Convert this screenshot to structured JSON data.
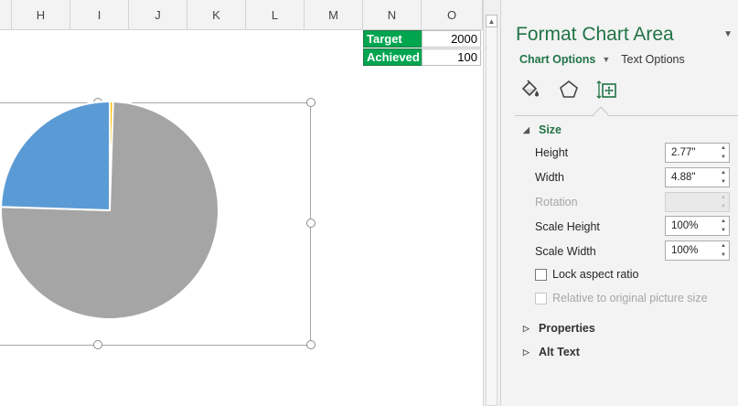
{
  "sheet": {
    "columns": [
      {
        "letter": "H"
      },
      {
        "letter": "I"
      },
      {
        "letter": "J"
      },
      {
        "letter": "K"
      },
      {
        "letter": "L"
      },
      {
        "letter": "M"
      },
      {
        "letter": "N"
      },
      {
        "letter": "O"
      }
    ],
    "cells": {
      "target_label": "Target",
      "target_value": "2000",
      "achieved_label": "Achieved",
      "achieved_value": "100"
    },
    "colors": {
      "header_green": "#00a54f",
      "pie_blue": "#5b9bd5",
      "pie_gray": "#a5a5a5",
      "pie_gold": "#ffc000"
    }
  },
  "chart_data": {
    "type": "pie",
    "slices": [
      {
        "value": 75,
        "color": "#a5a5a5"
      },
      {
        "value": 24.5,
        "color": "#5b9bd5"
      },
      {
        "value": 0.5,
        "color": "#ffc000"
      }
    ]
  },
  "pane": {
    "title": "Format Chart Area",
    "tabs": {
      "chart_options": "Chart Options",
      "text_options": "Text Options"
    },
    "icons": [
      "fill-line-icon",
      "effects-icon",
      "size-properties-icon"
    ],
    "sections": {
      "size": "Size",
      "properties": "Properties",
      "alt_text": "Alt Text"
    },
    "rows": {
      "height_label": "Height",
      "height_value": "2.77\"",
      "width_label": "Width",
      "width_value": "4.88\"",
      "rotation_label": "Rotation",
      "scale_height_label": "Scale Height",
      "scale_height_value": "100%",
      "scale_width_label": "Scale Width",
      "scale_width_value": "100%",
      "lock_aspect_label": "Lock aspect ratio",
      "relative_label": "Relative to original picture size"
    },
    "accent_color": "#217346"
  }
}
